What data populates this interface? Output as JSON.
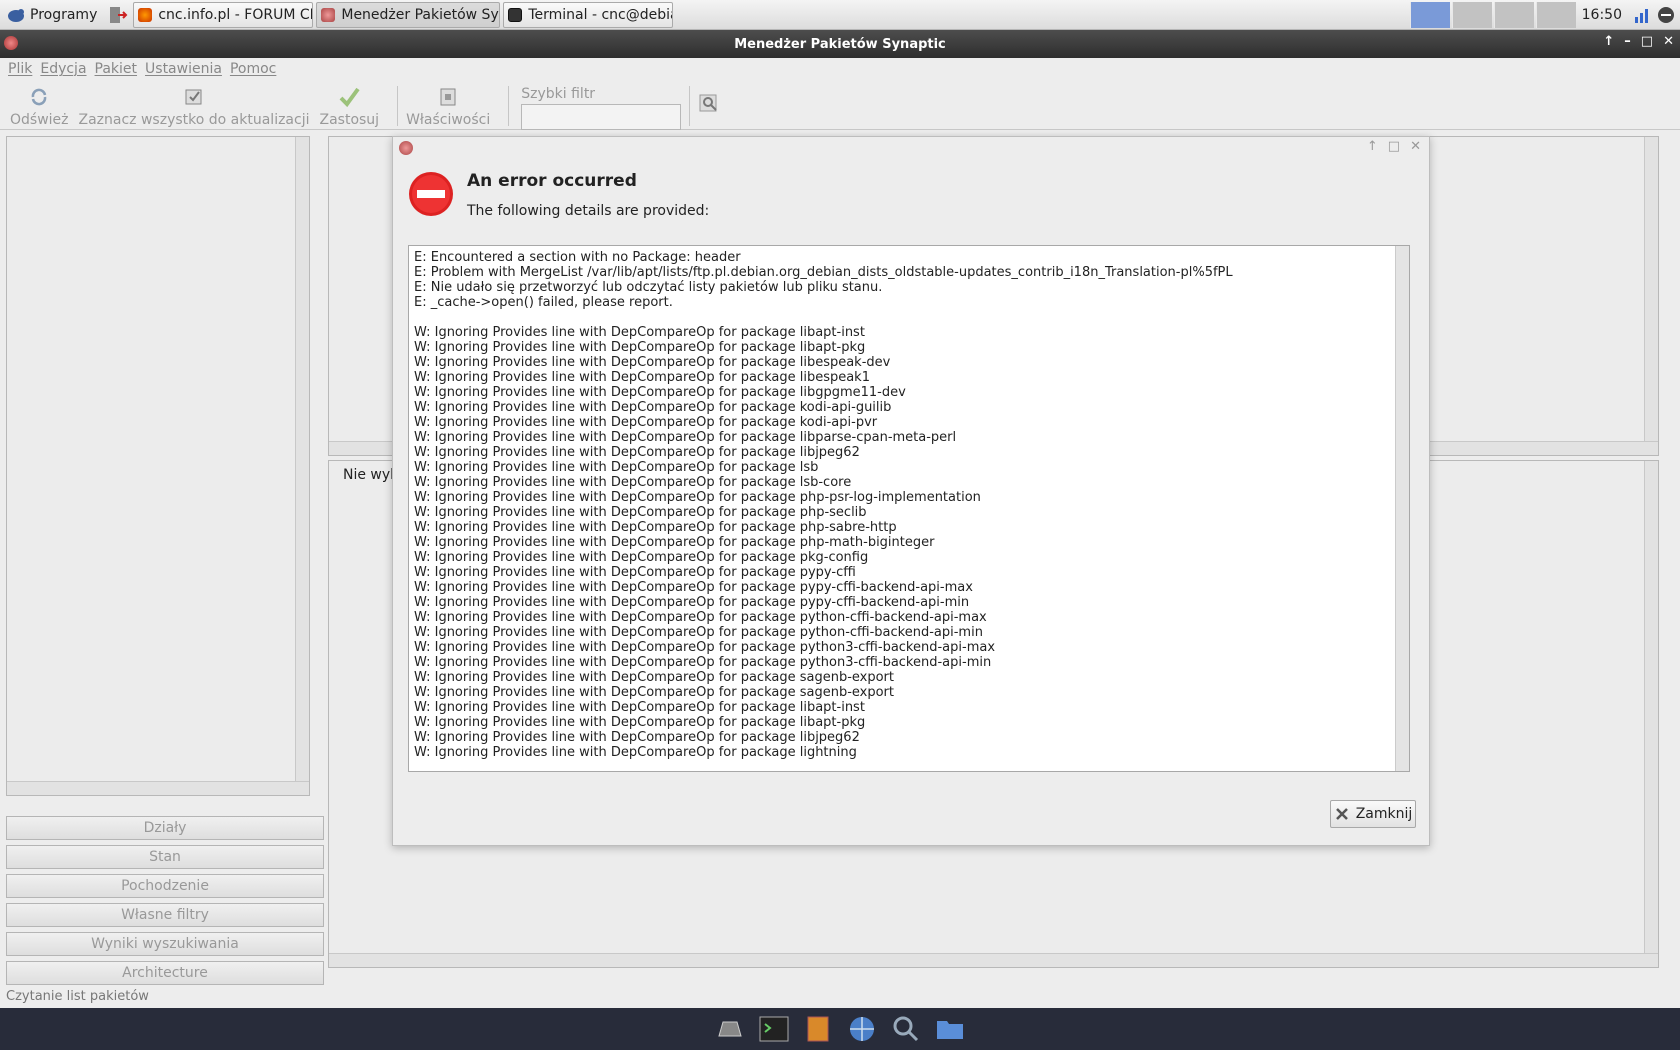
{
  "taskbar": {
    "start_label": "Programy",
    "tasks": [
      {
        "label": "cnc.info.pl - FORUM CNC..."
      },
      {
        "label": "Menedżer Pakietów Syn..."
      },
      {
        "label": "Terminal - cnc@debian: ~"
      }
    ],
    "clock": "16:50"
  },
  "window": {
    "title": "Menedżer Pakietów Synaptic",
    "menu": [
      "Plik",
      "Edycja",
      "Pakiet",
      "Ustawienia",
      "Pomoc"
    ],
    "toolbar": {
      "refresh": "Odśwież",
      "mark_all": "Zaznacz wszystko do aktualizacji",
      "apply": "Zastosuj",
      "properties": "Właściwości",
      "quick_filter_label": "Szybki filtr"
    },
    "filters": [
      "Działy",
      "Stan",
      "Pochodzenie",
      "Własne filtry",
      "Wyniki wyszukiwania",
      "Architecture"
    ],
    "no_selection": "Nie wyb",
    "status": "Czytanie list pakietów"
  },
  "dialog": {
    "title": "An error occurred",
    "subtitle": "The following details are provided:",
    "lines": [
      "E: Encountered a section with no Package: header",
      "E: Problem with MergeList /var/lib/apt/lists/ftp.pl.debian.org_debian_dists_oldstable-updates_contrib_i18n_Translation-pl%5fPL",
      "E: Nie udało się przetworzyć lub odczytać listy pakietów lub pliku stanu.",
      "E: _cache->open() failed, please report.",
      "",
      "W: Ignoring Provides line with DepCompareOp for package libapt-inst",
      "W: Ignoring Provides line with DepCompareOp for package libapt-pkg",
      "W: Ignoring Provides line with DepCompareOp for package libespeak-dev",
      "W: Ignoring Provides line with DepCompareOp for package libespeak1",
      "W: Ignoring Provides line with DepCompareOp for package libgpgme11-dev",
      "W: Ignoring Provides line with DepCompareOp for package kodi-api-guilib",
      "W: Ignoring Provides line with DepCompareOp for package kodi-api-pvr",
      "W: Ignoring Provides line with DepCompareOp for package libparse-cpan-meta-perl",
      "W: Ignoring Provides line with DepCompareOp for package libjpeg62",
      "W: Ignoring Provides line with DepCompareOp for package lsb",
      "W: Ignoring Provides line with DepCompareOp for package lsb-core",
      "W: Ignoring Provides line with DepCompareOp for package php-psr-log-implementation",
      "W: Ignoring Provides line with DepCompareOp for package php-seclib",
      "W: Ignoring Provides line with DepCompareOp for package php-sabre-http",
      "W: Ignoring Provides line with DepCompareOp for package php-math-biginteger",
      "W: Ignoring Provides line with DepCompareOp for package pkg-config",
      "W: Ignoring Provides line with DepCompareOp for package pypy-cffi",
      "W: Ignoring Provides line with DepCompareOp for package pypy-cffi-backend-api-max",
      "W: Ignoring Provides line with DepCompareOp for package pypy-cffi-backend-api-min",
      "W: Ignoring Provides line with DepCompareOp for package python-cffi-backend-api-max",
      "W: Ignoring Provides line with DepCompareOp for package python-cffi-backend-api-min",
      "W: Ignoring Provides line with DepCompareOp for package python3-cffi-backend-api-max",
      "W: Ignoring Provides line with DepCompareOp for package python3-cffi-backend-api-min",
      "W: Ignoring Provides line with DepCompareOp for package sagenb-export",
      "W: Ignoring Provides line with DepCompareOp for package sagenb-export",
      "W: Ignoring Provides line with DepCompareOp for package libapt-inst",
      "W: Ignoring Provides line with DepCompareOp for package libapt-pkg",
      "W: Ignoring Provides line with DepCompareOp for package libjpeg62",
      "W: Ignoring Provides line with DepCompareOp for package lightning"
    ],
    "close_label": "Zamknij"
  }
}
